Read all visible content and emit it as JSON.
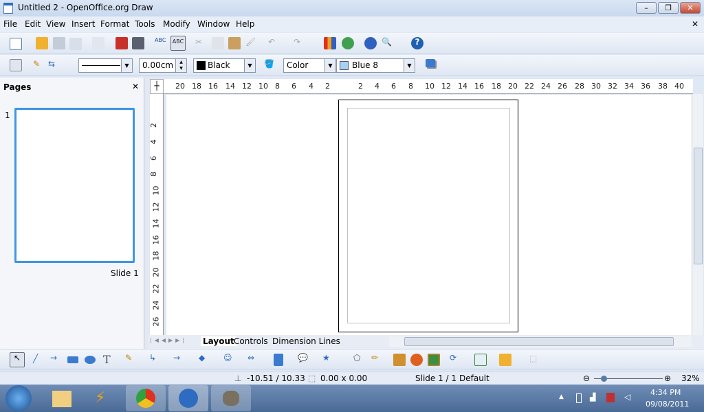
{
  "window": {
    "title": "Untitled 2 - OpenOffice.org Draw",
    "controls": [
      "minimize",
      "maximize",
      "close"
    ]
  },
  "menu": [
    "File",
    "Edit",
    "View",
    "Insert",
    "Format",
    "Tools",
    "Modify",
    "Window",
    "Help"
  ],
  "toolbar2": {
    "line_width": "0.00cm",
    "line_color": "Black",
    "area_style": "Color",
    "area_fill": "Blue 8",
    "fill_swatch": "#a8d0f5"
  },
  "pages_pane": {
    "title": "Pages",
    "slide_number": "1",
    "slide_label": "Slide 1"
  },
  "hruler": [
    "20",
    "18",
    "16",
    "14",
    "12",
    "10",
    "8",
    "6",
    "4",
    "2",
    "2",
    "4",
    "6",
    "8",
    "10",
    "12",
    "14",
    "16",
    "18",
    "20",
    "22",
    "24",
    "26",
    "28",
    "30",
    "32",
    "34",
    "36",
    "38",
    "40"
  ],
  "vruler": [
    "2",
    "4",
    "6",
    "8",
    "10",
    "12",
    "14",
    "16",
    "18",
    "20",
    "22",
    "24",
    "26"
  ],
  "tabs": [
    "Layout",
    "Controls",
    "Dimension Lines"
  ],
  "status": {
    "position": "-10.51 / 10.33",
    "size": "0.00 x 0.00",
    "slide": "Slide 1 / 1",
    "layout": "Default",
    "zoom": "32%"
  },
  "tray": {
    "time": "4:34 PM",
    "date": "09/08/2011"
  }
}
